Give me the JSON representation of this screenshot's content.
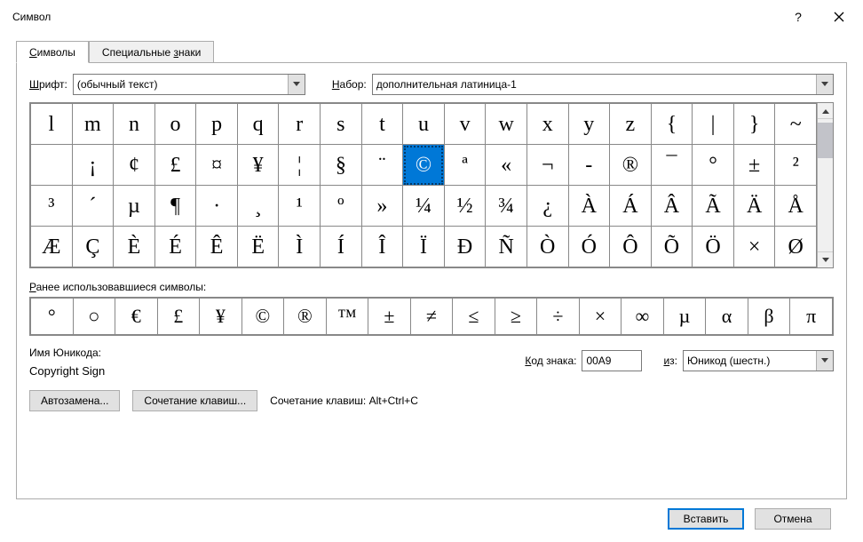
{
  "title": "Символ",
  "tabs": {
    "symbols": "Символы",
    "symbols_hot": "С",
    "special": "Специальные знаки",
    "special_hot": "з"
  },
  "font": {
    "label_pre": "Ш",
    "label_hot": "рифт",
    "label_suf": ":",
    "value": "(обычный текст)"
  },
  "subset": {
    "label_pre": "Н",
    "label_hot": "а",
    "label_suf": "бор:",
    "value": "дополнительная латиница-1"
  },
  "recent_label": "Ранее использовавшиеся символы:",
  "unicode_name_label": "Имя Юникода:",
  "unicode_name_value": "Copyright Sign",
  "code": {
    "label": "Код знака:",
    "label_hot": "К",
    "value": "00A9"
  },
  "from": {
    "label": "из:",
    "label_hot": "и",
    "value": "Юникод (шестн.)"
  },
  "autocorrect": "Автозамена...",
  "shortcut_btn": "Сочетание клавиш...",
  "shortcuts_label": "Сочетание клавиш:",
  "shortcuts_value": "Alt+Ctrl+C",
  "insert": "Вставить",
  "cancel": "Отмена",
  "grid": [
    [
      "l",
      "m",
      "n",
      "o",
      "p",
      "q",
      "r",
      "s",
      "t",
      "u",
      "v",
      "w",
      "x",
      "y",
      "z",
      "{",
      "|",
      "}",
      "~"
    ],
    [
      "",
      "¡",
      "¢",
      "£",
      "¤",
      "¥",
      "¦",
      "§",
      "¨",
      "©",
      "ª",
      "«",
      "¬",
      "-",
      "®",
      "¯",
      "°",
      "±",
      "²"
    ],
    [
      "³",
      "´",
      "µ",
      "¶",
      "·",
      "¸",
      "¹",
      "º",
      "»",
      "¼",
      "½",
      "¾",
      "¿",
      "À",
      "Á",
      "Â",
      "Ã",
      "Ä",
      "Å"
    ],
    [
      "Æ",
      "Ç",
      "È",
      "É",
      "Ê",
      "Ë",
      "Ì",
      "Í",
      "Î",
      "Ï",
      "Ð",
      "Ñ",
      "Ò",
      "Ó",
      "Ô",
      "Õ",
      "Ö",
      "×",
      "Ø"
    ]
  ],
  "selected": {
    "r": 1,
    "c": 9
  },
  "recent": [
    "°",
    "○",
    "€",
    "£",
    "¥",
    "©",
    "®",
    "™",
    "±",
    "≠",
    "≤",
    "≥",
    "÷",
    "×",
    "∞",
    "µ",
    "α",
    "β",
    "π"
  ]
}
